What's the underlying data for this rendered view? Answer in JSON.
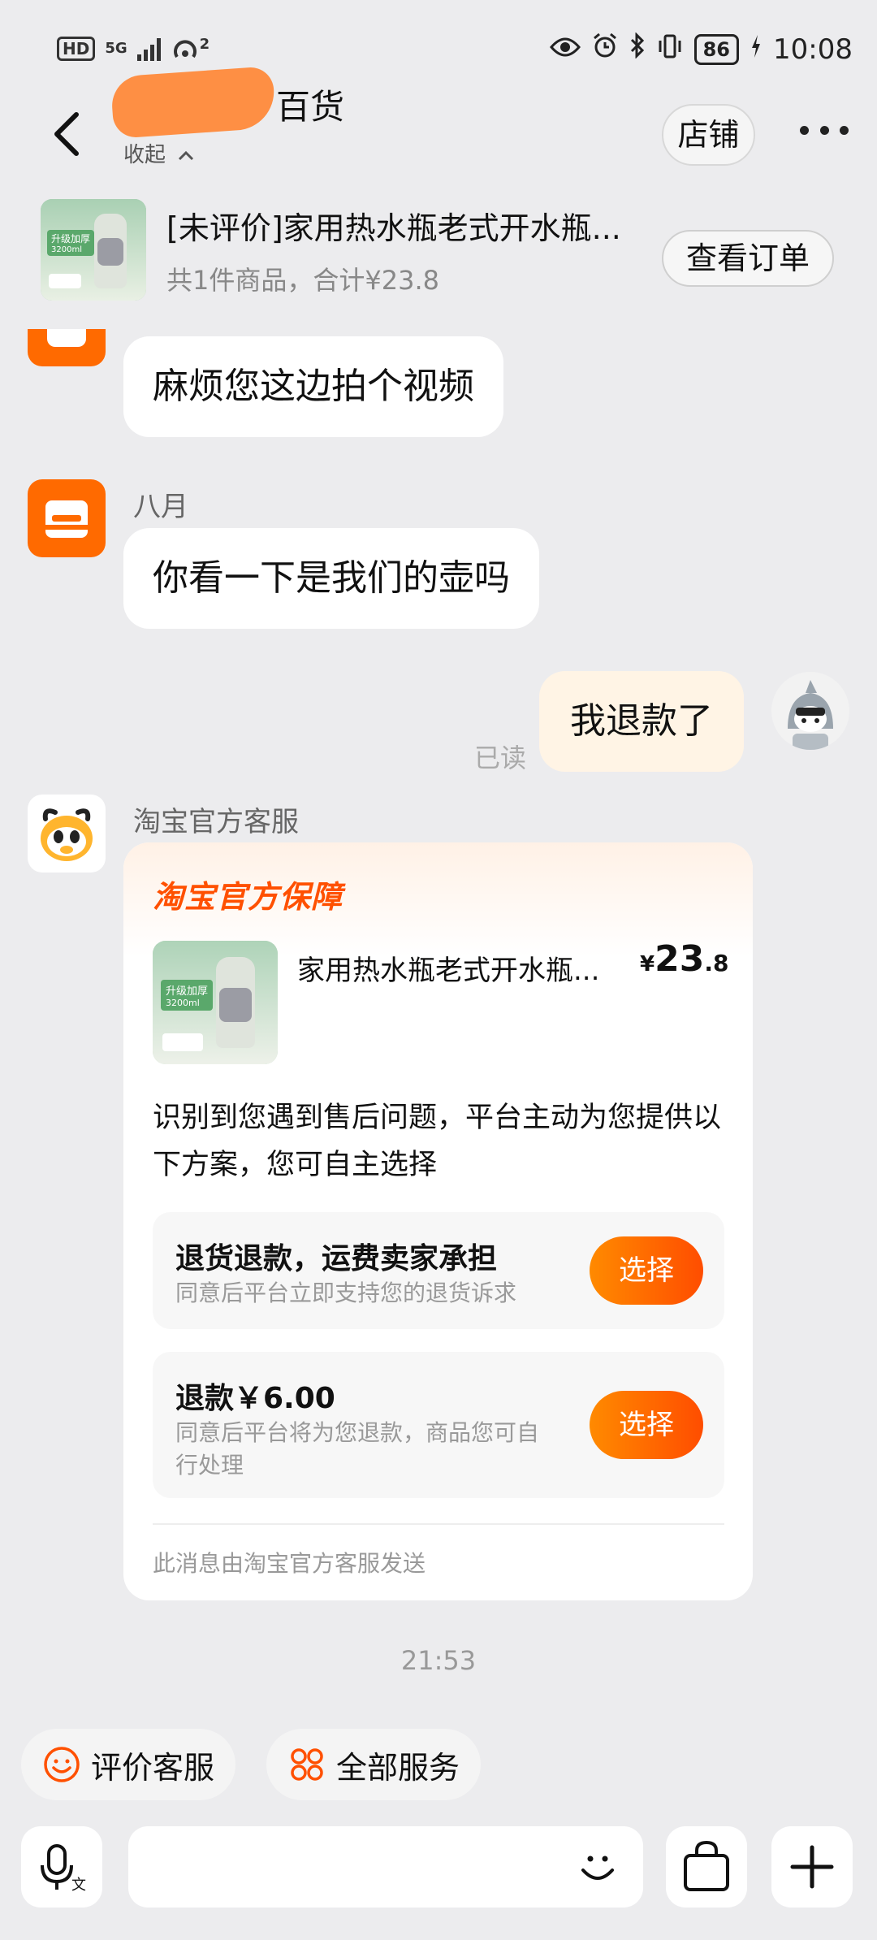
{
  "status_bar": {
    "hd": "HD",
    "network": "5G",
    "hotspot_count": "2",
    "battery": "86",
    "time": "10:08"
  },
  "header": {
    "shop_name_visible": "百货",
    "collapse_label": "收起",
    "shop_button": "店铺"
  },
  "order_bar": {
    "title": "[未评价]家用热水瓶老式开水瓶...",
    "summary": "共1件商品，合计¥23.8",
    "view_order_button": "查看订单",
    "thumb_badge": "升级加厚",
    "thumb_capacity": "3200ml"
  },
  "messages": {
    "m1_text": "麻烦您这边拍个视频",
    "m2_sender": "八月",
    "m2_text": "你看一下是我们的壶吗",
    "m3_text": "我退款了",
    "m3_status": "已读",
    "m4_sender": "淘宝官方客服"
  },
  "card": {
    "title": "淘宝官方保障",
    "product_name": "家用热水瓶老式开水瓶...",
    "price_symbol": "¥",
    "price_int": "23",
    "price_dec": ".8",
    "description": "识别到您遇到售后问题，平台主动为您提供以下方案，您可自主选择",
    "option1_title": "退货退款，运费卖家承担",
    "option1_desc": "同意后平台立即支持您的退货诉求",
    "option1_button": "选择",
    "option2_title": "退款￥6.00",
    "option2_desc": "同意后平台将为您退款，商品您可自行处理",
    "option2_button": "选择",
    "footer": "此消息由淘宝官方客服发送"
  },
  "timestamp": "21:53",
  "quick_actions": {
    "rate_service": "评价客服",
    "all_services": "全部服务"
  },
  "colors": {
    "accent": "#ff5000",
    "background": "#ececee",
    "my_bubble": "#fff4e5"
  }
}
